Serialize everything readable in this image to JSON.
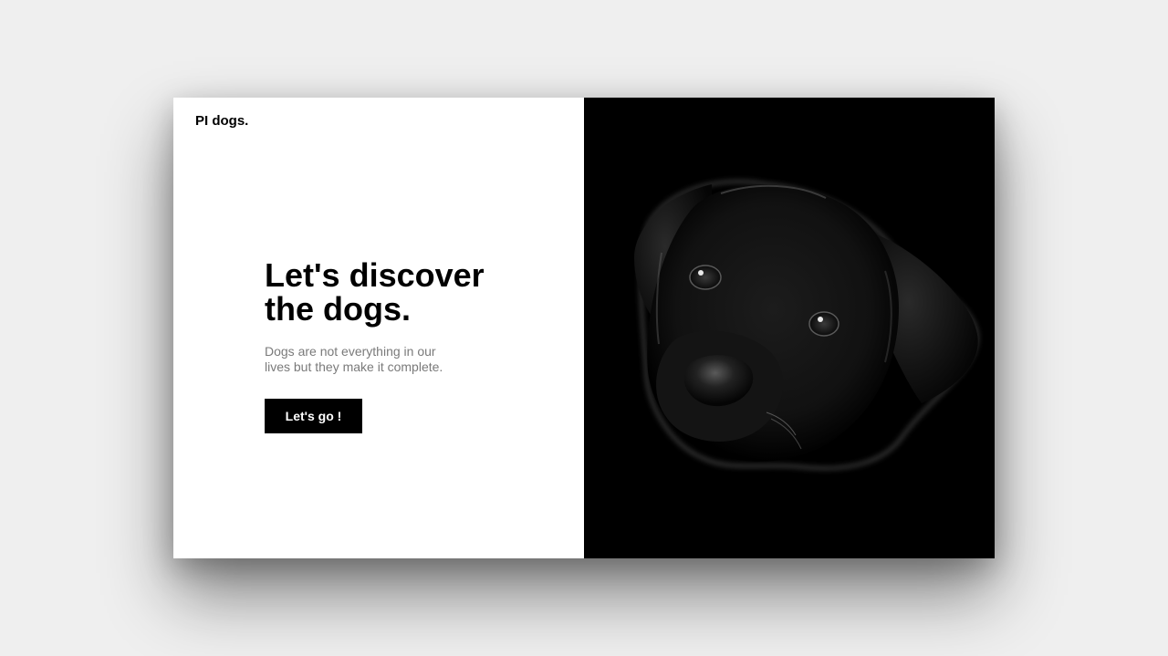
{
  "brand": {
    "logo_text": "PI dogs."
  },
  "hero": {
    "title_line1": "Let's discover",
    "title_line2": "the dogs.",
    "subtitle_line1": "Dogs are not everything in our",
    "subtitle_line2": "lives but they make it complete.",
    "cta_label": "Let's go !"
  },
  "image": {
    "subject": "black-labrador-puppy-portrait"
  },
  "colors": {
    "page_background": "#efefef",
    "card_background": "#ffffff",
    "image_background": "#000000",
    "button_background": "#000000",
    "button_text": "#ffffff",
    "subtitle_text": "#7a7a7a"
  }
}
